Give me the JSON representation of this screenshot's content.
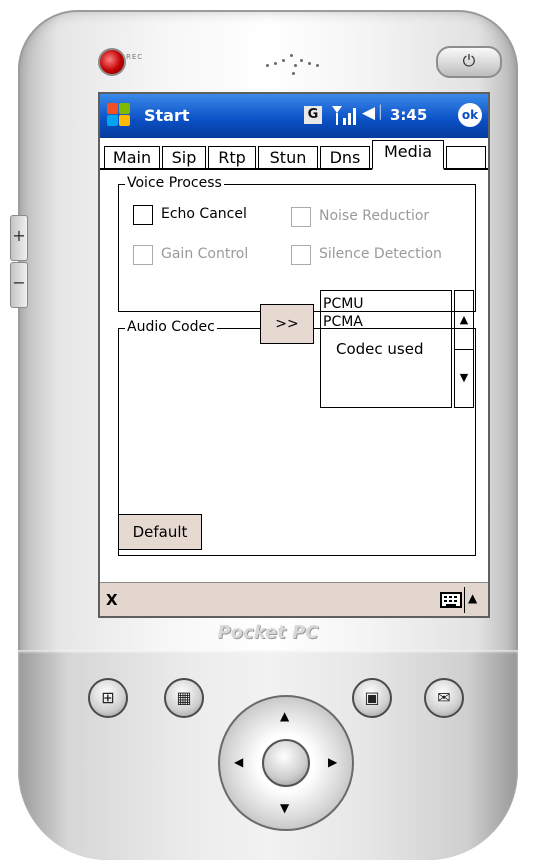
{
  "device": {
    "rec_label": "REC",
    "brand": "Pocket PC"
  },
  "titlebar": {
    "start_label": "Start",
    "g_label": "G",
    "time": "3:45",
    "ok_label": "ok",
    "color": "#0a4fc4"
  },
  "tabs": [
    "Main",
    "Sip",
    "Rtp",
    "Stun",
    "Dns",
    "Media"
  ],
  "active_tab": "Media",
  "voice_process": {
    "label": "Voice Process",
    "echo_cancel": "Echo Cancel",
    "noise_reduction": "Noise Reductior",
    "gain_control": "Gain Control",
    "silence_detection": "Silence Detection"
  },
  "audio_codec": {
    "label": "Audio Codec",
    "codec_used_label": "Codec used",
    "move_button": ">>",
    "codecs_used": [
      "PCMU",
      "PCMA"
    ],
    "default_button": "Default"
  },
  "command_bar": {
    "close_label": "X"
  }
}
